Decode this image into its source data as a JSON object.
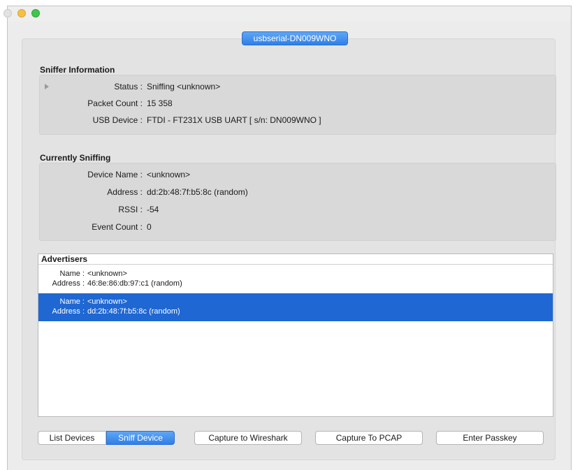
{
  "window": {
    "tab_title": "usbserial-DN009WNO"
  },
  "sniffer_information": {
    "title": "Sniffer Information",
    "rows": [
      {
        "label": "Status :",
        "value": "Sniffing <unknown>"
      },
      {
        "label": "Packet Count :",
        "value": "15 358"
      },
      {
        "label": "USB Device :",
        "value": "FTDI - FT231X USB UART [ s/n: DN009WNO ]"
      }
    ]
  },
  "currently_sniffing": {
    "title": "Currently Sniffing",
    "rows": [
      {
        "label": "Device Name :",
        "value": "<unknown>"
      },
      {
        "label": "Address :",
        "value": "dd:2b:48:7f:b5:8c (random)"
      },
      {
        "label": "RSSI :",
        "value": "-54"
      },
      {
        "label": "Event Count :",
        "value": "0"
      }
    ]
  },
  "advertisers": {
    "title": "Advertisers",
    "items": [
      {
        "name_label": "Name :",
        "name": "<unknown>",
        "address_label": "Address :",
        "address": "46:8e:86:db:97:c1 (random)",
        "selected": false
      },
      {
        "name_label": "Name :",
        "name": "<unknown>",
        "address_label": "Address :",
        "address": "dd:2b:48:7f:b5:8c (random)",
        "selected": true
      }
    ]
  },
  "buttons": {
    "list_devices": "List Devices",
    "sniff_device": "Sniff Device",
    "capture_wireshark": "Capture to Wireshark",
    "capture_pcap": "Capture To PCAP",
    "enter_passkey": "Enter Passkey"
  },
  "colors": {
    "accent": "#2f7fe8",
    "selection": "#1f67d2"
  }
}
